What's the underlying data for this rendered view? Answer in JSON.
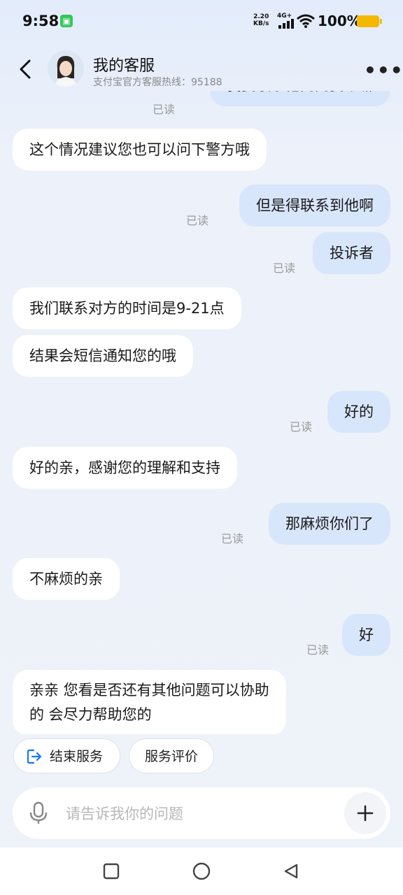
{
  "status_bar": {
    "time": "9:58",
    "net_speed_value": "2.20",
    "net_speed_unit": "KB/s",
    "network_type": "4G+",
    "battery": "100%"
  },
  "header": {
    "title": "我的客服",
    "subtitle": "支付宝官方客服热线：95188"
  },
  "messages": [
    {
      "from": "user",
      "text": "我要联系他问问要个嘛",
      "read": "已读"
    },
    {
      "from": "agent",
      "text": "这个情况建议您也可以问下警方哦"
    },
    {
      "from": "user",
      "text": "但是得联系到他啊",
      "read": "已读"
    },
    {
      "from": "user",
      "text": "投诉者",
      "read": "已读"
    },
    {
      "from": "agent",
      "text": "我们联系对方的时间是9-21点"
    },
    {
      "from": "agent",
      "text": "结果会短信通知您的哦"
    },
    {
      "from": "user",
      "text": "好的",
      "read": "已读"
    },
    {
      "from": "agent",
      "text": "好的亲，感谢您的理解和支持"
    },
    {
      "from": "user",
      "text": "那麻烦你们了",
      "read": "已读"
    },
    {
      "from": "agent",
      "text": "不麻烦的亲"
    },
    {
      "from": "user",
      "text": "好",
      "read": "已读"
    },
    {
      "from": "agent",
      "text_line1": "亲亲 您看是否还有其他问题可以协助",
      "text_line2": "的 会尽力帮助您的"
    }
  ],
  "actions": {
    "end_service": "结束服务",
    "rate_service": "服务评价"
  },
  "input": {
    "placeholder": "请告诉我你的问题"
  },
  "colors": {
    "user_bubble": "#d8e6fb",
    "agent_bubble": "#ffffff",
    "accent": "#1677ff"
  }
}
